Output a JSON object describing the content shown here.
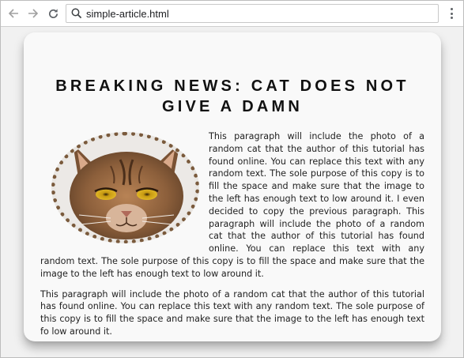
{
  "browser": {
    "url": "simple-article.html"
  },
  "article": {
    "title": "BREAKING NEWS: CAT DOES NOT GIVE A DAMN",
    "paragraphs": [
      "This paragraph will include the photo of a random cat that the author of this tutorial has found online. You can replace this text with any random text. The sole purpose of this copy is to fill the space and make sure that the image to the left has enough text to low around it. I even decided to copy the previous paragraph. This paragraph will include the photo of a random cat that the author of this tutorial has found online. You can replace this text with any random text. The sole purpose of this copy is to fill the space and make sure that the image to the left has enough text to low around it.",
      "This paragraph will include the photo of a random cat that the author of this tutorial has found online. You can replace this text with any random text. The sole purpose of this copy is to fill the space and make sure that the image to the left has enough text fo low around it."
    ]
  },
  "colors": {
    "frame_border": "#7a5a3c",
    "card_bg": "#f9f9f9",
    "page_bg": "#f1f1f1"
  },
  "icons": [
    "back-arrow-icon",
    "forward-arrow-icon",
    "reload-icon",
    "search-icon",
    "menu-dots-icon"
  ]
}
